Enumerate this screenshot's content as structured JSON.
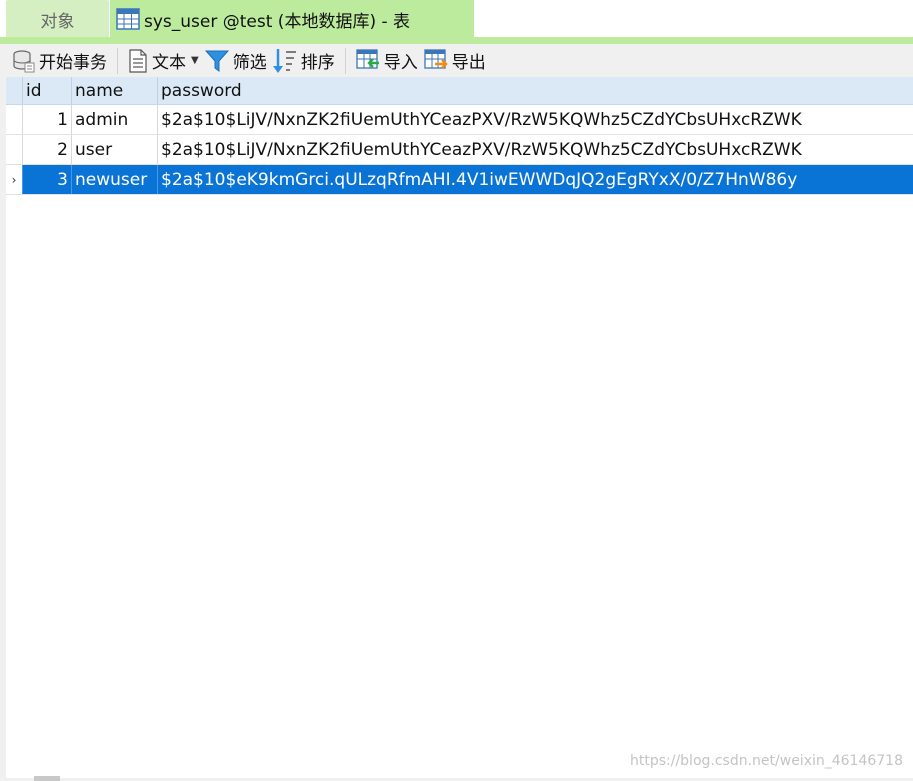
{
  "tabs": [
    {
      "label": "对象",
      "active": false
    },
    {
      "label": "sys_user @test (本地数据库) - 表",
      "active": true
    }
  ],
  "toolbar": {
    "begin_transaction": "开始事务",
    "text": "文本",
    "filter": "筛选",
    "sort": "排序",
    "import": "导入",
    "export": "导出"
  },
  "grid": {
    "columns": [
      "id",
      "name",
      "password"
    ],
    "rows": [
      {
        "id": "1",
        "name": "admin",
        "password": "$2a$10$LiJV/NxnZK2fiUemUthYCeazPXV/RzW5KQWhz5CZdYCbsUHxcRZWK"
      },
      {
        "id": "2",
        "name": "user",
        "password": "$2a$10$LiJV/NxnZK2fiUemUthYCeazPXV/RzW5KQWhz5CZdYCbsUHxcRZWK"
      },
      {
        "id": "3",
        "name": "newuser",
        "password": "$2a$10$eK9kmGrci.qULzqRfmAHI.4V1iwEWWDqJQ2gEgRYxX/0/Z7HnW86y",
        "selected": true
      }
    ],
    "row_indicator": "›"
  },
  "watermark": "https://blog.csdn.net/weixin_46146718",
  "colors": {
    "tab_active": "#bdeb9d",
    "tab_inactive": "#d6efc2",
    "header_bg": "#dbe9f7",
    "selection": "#0a74d6"
  }
}
